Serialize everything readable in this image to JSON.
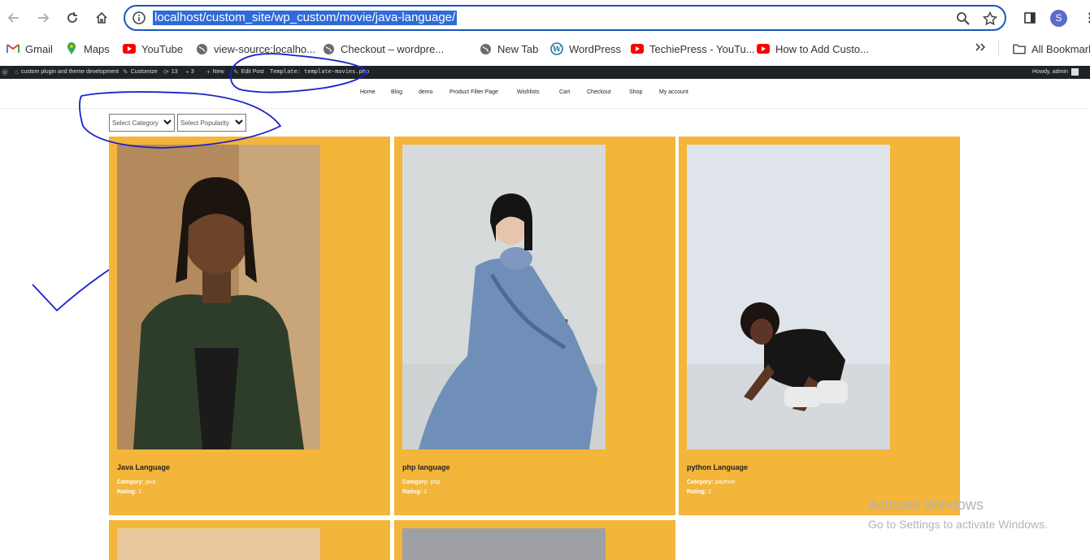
{
  "browser": {
    "url": "localhost/custom_site/wp_custom/movie/java-language/",
    "profile_initial": "S",
    "bookmarks": [
      {
        "label": "Gmail",
        "icon": "gmail-icon"
      },
      {
        "label": "Maps",
        "icon": "maps-icon"
      },
      {
        "label": "YouTube",
        "icon": "youtube-icon"
      },
      {
        "label": "view-source:localho...",
        "icon": "globe-icon"
      },
      {
        "label": "Checkout – wordpre...",
        "icon": "globe-icon"
      },
      {
        "label": "New Tab",
        "icon": "globe-icon"
      },
      {
        "label": "WordPress",
        "icon": "wordpress-icon"
      },
      {
        "label": "TechiePress - YouTu...",
        "icon": "youtube-icon"
      },
      {
        "label": "How to Add Custo...",
        "icon": "youtube-icon"
      }
    ],
    "all_bookmarks": "All Bookmarks"
  },
  "adminbar": {
    "site_name": "custom plugin and theme development",
    "customize": "Customize",
    "updates": "13",
    "comments": "3",
    "new": "New",
    "edit_post": "Edit Post",
    "template": "Template: template-movies.php",
    "howdy": "Howdy, admin"
  },
  "nav": [
    "Home",
    "Blog",
    "demo",
    "Product Filter Page",
    "Wishlists",
    "Cart",
    "Checkout",
    "Shop",
    "My account"
  ],
  "filters": {
    "category": "Select Category",
    "popularity": "Select Popularity"
  },
  "cards": [
    {
      "title": "Java Language",
      "category_label": "Category:",
      "category": "java",
      "rating_label": "Rating:",
      "rating": "1"
    },
    {
      "title": "php language",
      "category_label": "Category:",
      "category": "php",
      "rating_label": "Rating:",
      "rating": "3"
    },
    {
      "title": "python Language",
      "category_label": "Category:",
      "category": "paython",
      "rating_label": "Rating:",
      "rating": "2"
    }
  ],
  "watermark": {
    "line1": "Activate Windows",
    "line2": "Go to Settings to activate Windows."
  },
  "colors": {
    "card_bg": "#f3b53a",
    "admin_bar": "#1d2327",
    "omnibox_border": "#1a56c4",
    "annotation_ink": "#1a22c8"
  }
}
